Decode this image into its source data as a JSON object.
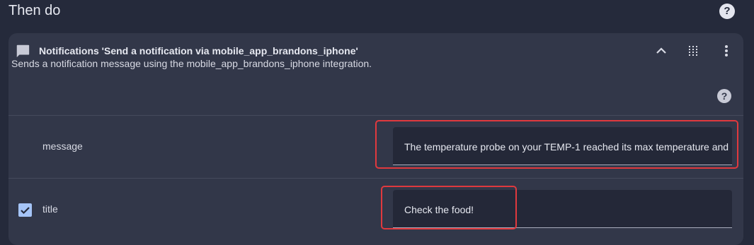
{
  "section": {
    "title": "Then do"
  },
  "action": {
    "header_title": "Notifications 'Send a notification via mobile_app_brandons_iphone'",
    "description": "Sends a notification message using the mobile_app_brandons_iphone integration."
  },
  "fields": {
    "message": {
      "label": "message",
      "value": "The temperature probe on your TEMP-1 reached its max temperature and"
    },
    "title": {
      "label": "title",
      "value": "Check the food!",
      "checked": true
    }
  },
  "icons": {
    "help": "question-circle-icon",
    "header": "chat-bubble-icon",
    "collapse": "chevron-up-icon",
    "drag": "drag-grid-icon",
    "menu": "more-vertical-icon",
    "checkbox": "checkbox-checked-icon"
  },
  "colors": {
    "background": "#252a3b",
    "card": "#323749",
    "field": "#242838",
    "highlight": "#e0393e",
    "checkbox": "#a5c4f7"
  }
}
